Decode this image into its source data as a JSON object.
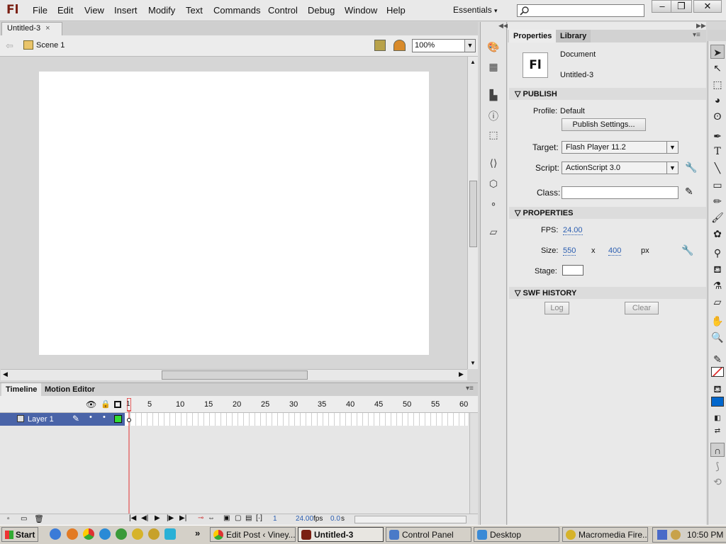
{
  "app": {
    "logo": "Fl",
    "workspace": "Essentials",
    "workspace_arrow": "▾"
  },
  "menu": [
    "File",
    "Edit",
    "View",
    "Insert",
    "Modify",
    "Text",
    "Commands",
    "Control",
    "Debug",
    "Window",
    "Help"
  ],
  "window_controls": {
    "minimize": "–",
    "restore": "❐",
    "close": "✕"
  },
  "document": {
    "tab_title": "Untitled-3",
    "tab_close": "×",
    "scene": "Scene 1",
    "zoom": "100%"
  },
  "timeline": {
    "tabs": [
      "Timeline",
      "Motion Editor"
    ],
    "ruler": [
      "1",
      "5",
      "10",
      "15",
      "20",
      "25",
      "30",
      "35",
      "40",
      "45",
      "50",
      "55",
      "60"
    ],
    "layer_name": "Layer 1",
    "current_frame": "1",
    "fps": "24.00",
    "fps_unit": "fps",
    "time": "0.0",
    "time_unit": "s"
  },
  "properties": {
    "tabs": [
      "Properties",
      "Library"
    ],
    "doc_icon": "Fl",
    "doc_type": "Document",
    "doc_name": "Untitled-3",
    "sections": {
      "publish": "PUBLISH",
      "properties": "PROPERTIES",
      "swf_history": "SWF HISTORY"
    },
    "profile_label": "Profile:",
    "profile_value": "Default",
    "publish_settings": "Publish Settings...",
    "target_label": "Target:",
    "target_value": "Flash Player 11.2",
    "script_label": "Script:",
    "script_value": "ActionScript 3.0",
    "class_label": "Class:",
    "class_value": "",
    "fps_label": "FPS:",
    "fps_value": "24.00",
    "size_label": "Size:",
    "width": "550",
    "x_sep": "x",
    "height": "400",
    "size_unit": "px",
    "stage_label": "Stage:",
    "stage_color": "#ffffff",
    "log_button": "Log",
    "clear_button": "Clear"
  },
  "taskbar": {
    "start": "Start",
    "overflow": "»",
    "tasks": [
      "Edit Post ‹ Viney...",
      "Untitled-3",
      "Control Panel",
      "Desktop",
      "Macromedia Fire..."
    ],
    "clock": "10:50 PM"
  },
  "colors": {
    "layer_highlight": "#4a64a8",
    "playhead": "#e03030",
    "accent_blue": "#0a5fd6",
    "fill_blue": "#0066cc"
  }
}
